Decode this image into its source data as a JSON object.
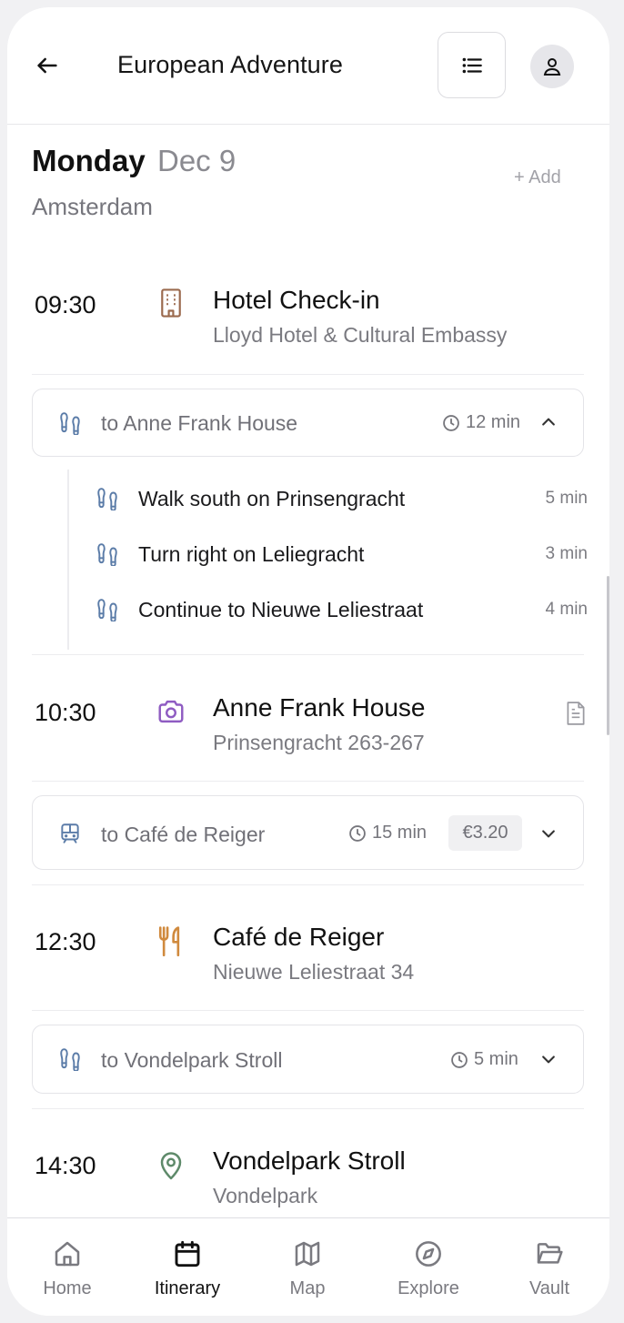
{
  "header": {
    "title": "European Adventure",
    "back_icon": "arrow-left-icon",
    "menu_icon": "list-icon",
    "profile_icon": "user-icon"
  },
  "day": {
    "weekday": "Monday",
    "date": "Dec 9",
    "city": "Amsterdam",
    "add_label": "+ Add"
  },
  "events": [
    {
      "time": "09:30",
      "name": "Hotel Check-in",
      "location": "Lloyd Hotel & Cultural Embassy",
      "icon": "building-icon",
      "icon_color": "#9b6a4e"
    },
    {
      "time": "10:30",
      "name": "Anne Frank House",
      "location": "Prinsengracht 263-267",
      "icon": "camera-icon",
      "icon_color": "#8f5cc2",
      "has_note": true
    },
    {
      "time": "12:30",
      "name": "Café de Reiger",
      "location": "Nieuwe Leliestraat 34",
      "icon": "utensils-icon",
      "icon_color": "#d08a3e"
    },
    {
      "time": "14:30",
      "name": "Vondelpark Stroll",
      "location": "Vondelpark",
      "icon": "map-pin-icon",
      "icon_color": "#5e8a6a"
    }
  ],
  "transits": [
    {
      "label": "to Anne Frank House",
      "duration": "12 min",
      "mode": "footprints-icon",
      "expanded": true,
      "steps": [
        {
          "label": "Walk south on Prinsengracht",
          "duration": "5 min"
        },
        {
          "label": "Turn right on Leliegracht",
          "duration": "3 min"
        },
        {
          "label": "Continue to Nieuwe Leliestraat",
          "duration": "4 min"
        }
      ]
    },
    {
      "label": "to Café de Reiger",
      "duration": "15 min",
      "cost": "€3.20",
      "mode": "tram-icon",
      "expanded": false
    },
    {
      "label": "to Vondelpark Stroll",
      "duration": "5 min",
      "mode": "footprints-icon",
      "expanded": false
    }
  ],
  "nav": {
    "active": "Itinerary",
    "items": [
      {
        "label": "Home",
        "icon": "home-icon"
      },
      {
        "label": "Itinerary",
        "icon": "calendar-icon"
      },
      {
        "label": "Map",
        "icon": "map-icon"
      },
      {
        "label": "Explore",
        "icon": "compass-icon"
      },
      {
        "label": "Vault",
        "icon": "folder-open-icon"
      }
    ]
  },
  "colors": {
    "accent_transit": "#5b7ca8",
    "muted_text": "#7a7a80",
    "border": "#e4e4e8"
  }
}
